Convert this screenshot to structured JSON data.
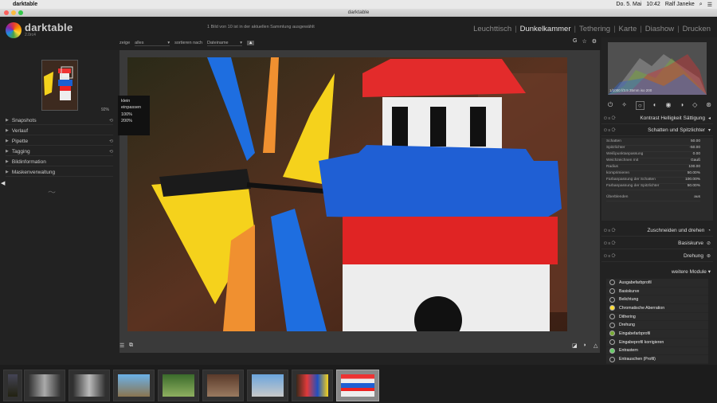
{
  "macos": {
    "app_name": "darktable",
    "status_items": [
      "Do. 5. Mai",
      "10:42",
      "Ralf Janeke"
    ]
  },
  "window": {
    "title": "darktable"
  },
  "header": {
    "logo_text": "darktable",
    "logo_version": "2.0rc4",
    "status": "1 Bild von 10 ist in der aktuellen Sammlung ausgewählt",
    "views": [
      "Leuchttisch",
      "Dunkelkammer",
      "Tethering",
      "Karte",
      "Diashow",
      "Drucken"
    ],
    "active_view": "Dunkelkammer"
  },
  "filter_bar": {
    "show_label": "zeige",
    "show_value": "alles",
    "sort_label": "sortieren nach",
    "sort_value": "Dateiname"
  },
  "left_panel": {
    "zoom_percent": "92%",
    "modules": [
      "Snapshots",
      "Verlauf",
      "Pipette",
      "Tagging",
      "Bildinformation",
      "Maskenverwaltung"
    ],
    "zoom_menu": [
      "klein",
      "einpassen",
      "100%",
      "200%"
    ]
  },
  "right_panel": {
    "histogram_info": "1/1000 f/3.5 35mm iso 200",
    "modules": [
      {
        "name": "Kontrast Helligkeit Sättigung"
      },
      {
        "name": "Schatten und Spitzlichter"
      }
    ],
    "params": [
      {
        "label": "Schatten",
        "value": "50.00"
      },
      {
        "label": "Spitzlichter",
        "value": "-50.00"
      },
      {
        "label": "Weißpunktanpassung",
        "value": "0.00"
      },
      {
        "label": "Weichzeichnen mit",
        "value": "Gauß"
      },
      {
        "label": "Radius",
        "value": "100.00"
      },
      {
        "label": "komprimieren",
        "value": "50.00%"
      },
      {
        "label": "Farbanpassung der Schatten",
        "value": "100.00%"
      },
      {
        "label": "Farbanpassung der Spitzlichter",
        "value": "50.00%"
      },
      {
        "label": "Überblenden",
        "value": "aus"
      }
    ],
    "modules2": [
      "Zuschneiden und drehen",
      "Basiskurve",
      "Drehung"
    ],
    "more_modules": "weitere Module",
    "more_list": [
      "Ausgabefarbprofil",
      "Basiskurve",
      "Belichtung",
      "Chromatische Aberration",
      "Dithering",
      "Drehung",
      "Eingabefarbprofil",
      "Eingabeprofil korrigieren",
      "Entrastern",
      "Entrauschen (Profil)"
    ]
  }
}
